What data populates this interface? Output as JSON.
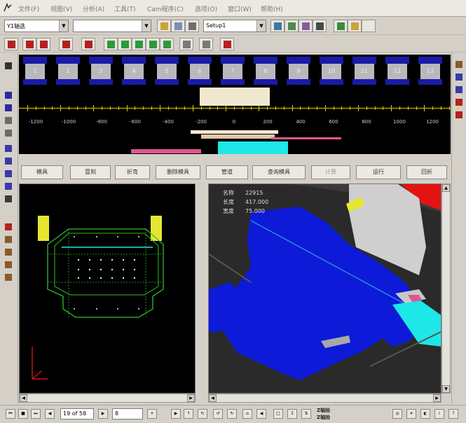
{
  "menu": {
    "items": [
      "文件(F)",
      "视图(V)",
      "分析(A)",
      "工具(T)",
      "Cam程序(C)",
      "选项(O)",
      "窗口(W)",
      "帮助(H)"
    ]
  },
  "toolbar": {
    "mode_select": "Y1轴选",
    "blank_combo": "",
    "setup_combo": "Setup1"
  },
  "tool_slots": [
    "1",
    "2",
    "3",
    "4",
    "5",
    "6",
    "7",
    "8",
    "9",
    "10",
    "11",
    "12",
    "13"
  ],
  "ruler": {
    "labels": [
      "-1200",
      "-1000",
      "-800",
      "-600",
      "-400",
      "-200",
      "0",
      "200",
      "400",
      "600",
      "800",
      "1000",
      "1200"
    ]
  },
  "actions": {
    "buttons": [
      "模具",
      "冒刻",
      "折弯",
      "删除模具",
      "管道",
      "查询模具",
      "计算",
      "运行",
      "回折"
    ]
  },
  "info": {
    "label_name": "名称",
    "value_name": "22915",
    "label_length": "长度",
    "value_length": "417.000",
    "label_width": "宽度",
    "value_width": "75.000"
  },
  "status": {
    "page": "19 of 58",
    "zoom": "8",
    "zaxis_label_1": "Z轴抬",
    "zaxis_label_2": "Z轴抬"
  },
  "colors": {
    "tool_blue": "#1a1aa8",
    "part_blue": "#0d1ad8",
    "cyan": "#1de7e7",
    "pink": "#e0558f",
    "ruler_yellow": "#d8d000",
    "outline_green": "#2fbf2f",
    "fixture_yellow": "#e6e630"
  }
}
